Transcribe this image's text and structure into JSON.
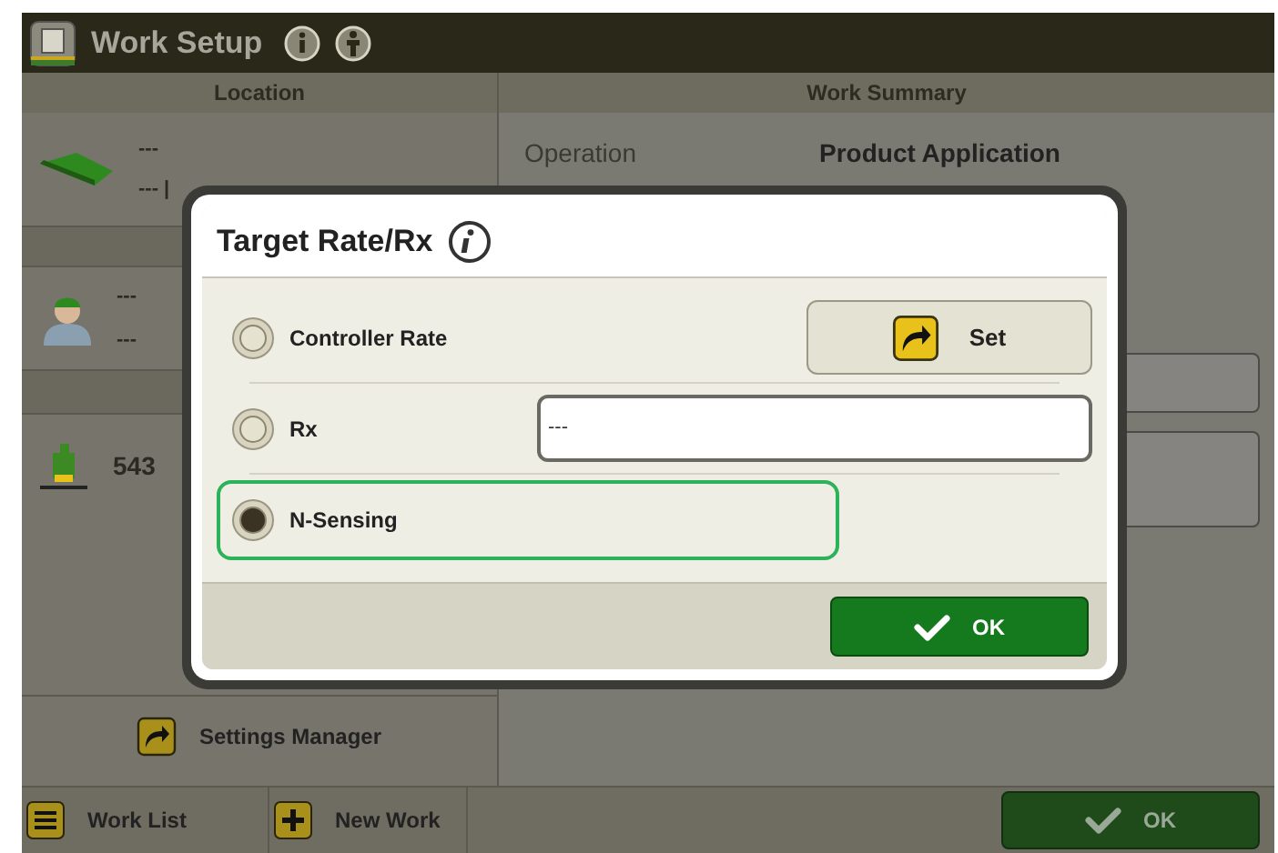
{
  "window": {
    "title": "Work Setup"
  },
  "location_panel": {
    "heading": "Location",
    "location": {
      "line_1": "---",
      "line_2": "--- |"
    },
    "operator": {
      "line_1": "---",
      "line_2": "---"
    },
    "machine": {
      "name": "543"
    },
    "settings_button": "Settings Manager"
  },
  "work_summary": {
    "heading": "Work Summary",
    "rows": [
      {
        "label": "Operation",
        "value": "Product Application"
      }
    ]
  },
  "toolbar": {
    "buttons": [
      {
        "label": "Work List",
        "kind": "list"
      },
      {
        "label": "New Work",
        "kind": "add"
      }
    ],
    "ok_button": "OK"
  },
  "dialog": {
    "title": "Target Rate/Rx",
    "options": [
      {
        "label": "Controller Rate",
        "selected": false,
        "kind": "button",
        "button_label": "Set"
      },
      {
        "label": "Rx",
        "selected": false,
        "kind": "field",
        "value": "---"
      },
      {
        "label": "N-Sensing",
        "selected": true,
        "kind": "plain"
      }
    ],
    "ok_button": "OK"
  }
}
